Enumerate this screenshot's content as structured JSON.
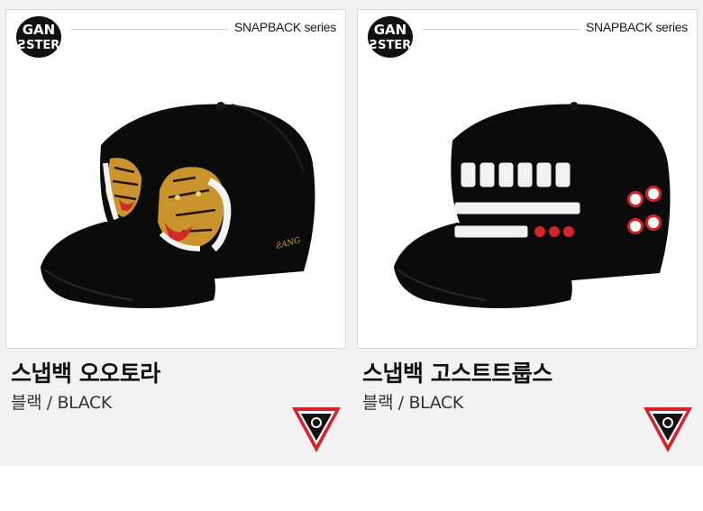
{
  "colors": {
    "background": "#f2f2f2",
    "card": "#ffffff",
    "badge_red": "#d6232a",
    "cap": "#0b0b0b"
  },
  "products": [
    {
      "series": "SNAPBACK series",
      "logo_icon": "gangster-brand-logo",
      "name": "스냅백 오오토라",
      "color": "블랙 / BLACK",
      "image_icon": "black-snapback-tiger-embroidery",
      "badge_icon": "triangle-brand-badge"
    },
    {
      "series": "SNAPBACK series",
      "logo_icon": "gangster-brand-logo",
      "name": "스냅백 고스트트룹스",
      "color": "블랙 / BLACK",
      "image_icon": "black-snapback-text-embroidery",
      "badge_icon": "triangle-brand-badge"
    }
  ]
}
